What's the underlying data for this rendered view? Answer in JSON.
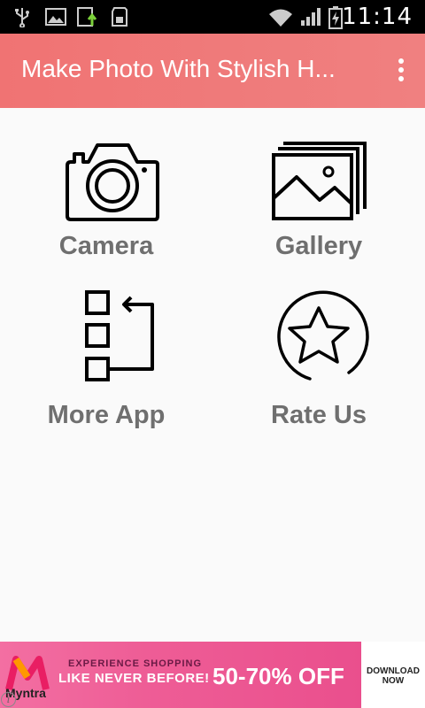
{
  "status_bar": {
    "time": "11:14",
    "icons": [
      "usb-icon",
      "image-icon",
      "download-icon",
      "sd-card-icon",
      "wifi-icon",
      "signal-icon",
      "battery-charging-icon"
    ]
  },
  "app_bar": {
    "title": "Make Photo With Stylish H...",
    "menu_icon": "overflow-menu-icon"
  },
  "menu": {
    "items": [
      {
        "label": "Camera",
        "icon": "camera-icon"
      },
      {
        "label": "Gallery",
        "icon": "gallery-icon"
      },
      {
        "label": "More App",
        "icon": "more-apps-icon"
      },
      {
        "label": "Rate Us",
        "icon": "star-icon"
      }
    ]
  },
  "ad": {
    "brand": "Myntra",
    "line1": "EXPERIENCE SHOPPING",
    "line2": "LIKE NEVER BEFORE!",
    "offer": "50-70% OFF",
    "cta": "DOWNLOAD NOW",
    "info_icon": "info-icon"
  },
  "colors": {
    "app_bar": "#f07373",
    "label_text": "#6f6f6f",
    "background": "#fafafa",
    "ad_pink": "#ee5d96"
  }
}
